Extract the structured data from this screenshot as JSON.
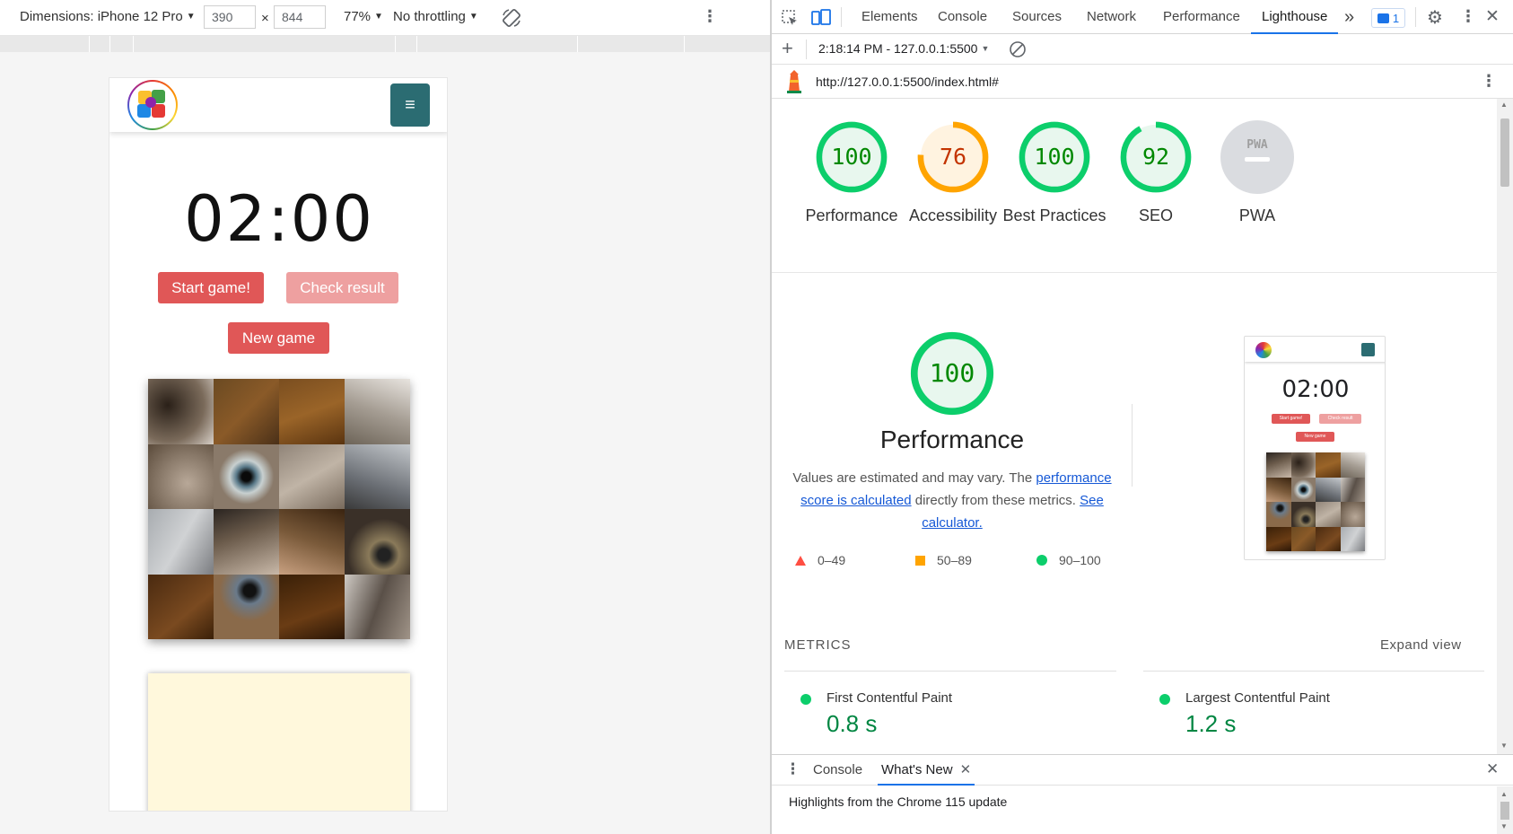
{
  "device_toolbar": {
    "dimensions_label": "Dimensions: iPhone 12 Pro",
    "width": "390",
    "height": "844",
    "times": "×",
    "zoom": "77%",
    "throttling": "No throttling",
    "rotate_icon": "rotate-icon",
    "more_icon": "more-vert-icon"
  },
  "app": {
    "timer": "02:00",
    "start_button": "Start game!",
    "check_button": "Check result",
    "new_game_button": "New game",
    "menu_icon": "≡",
    "colors": {
      "nav_button": "#2b6c72",
      "button": "#e05757",
      "button_disabled": "#eea0a0",
      "answer_box": "#fff8dc"
    }
  },
  "devtools": {
    "tabs": [
      "Elements",
      "Console",
      "Sources",
      "Network",
      "Performance",
      "Lighthouse"
    ],
    "active_tab": "Lighthouse",
    "overflow": "»",
    "issues_count": "1",
    "report_time": "2:18:14 PM - 127.0.0.1:5500",
    "url": "http://127.0.0.1:5500/index.html#"
  },
  "gauges": [
    {
      "label": "Performance",
      "score": "100",
      "value": 100,
      "color": "#0cce6b",
      "text_color": "#008800"
    },
    {
      "label": "Accessibility",
      "score": "76",
      "value": 76,
      "color": "#ffa400",
      "text_color": "#c33300"
    },
    {
      "label": "Best Practices",
      "score": "100",
      "value": 100,
      "color": "#0cce6b",
      "text_color": "#008800"
    },
    {
      "label": "SEO",
      "score": "92",
      "value": 92,
      "color": "#0cce6b",
      "text_color": "#008800"
    },
    {
      "label": "PWA",
      "score": "PWA",
      "value": 0,
      "color": "#dadce0",
      "text_color": "#9e9e9e"
    }
  ],
  "performance": {
    "score": "100",
    "title": "Performance",
    "desc_prefix": "Values are estimated and may vary. The ",
    "desc_link1": "performance score is calculated",
    "desc_middle": " directly from these metrics. ",
    "desc_link2": "See calculator.",
    "legend": [
      {
        "range": "0–49",
        "shape": "triangle",
        "color": "#ff4e42"
      },
      {
        "range": "50–89",
        "shape": "square",
        "color": "#ffa400"
      },
      {
        "range": "90–100",
        "shape": "circle",
        "color": "#0cce6b"
      }
    ],
    "thumb": {
      "timer": "02:00",
      "start": "Start game!",
      "check": "Check result",
      "new_game": "New game"
    }
  },
  "metrics": {
    "title": "METRICS",
    "expand": "Expand view",
    "items": [
      {
        "name": "First Contentful Paint",
        "value": "0.8 s"
      },
      {
        "name": "Largest Contentful Paint",
        "value": "1.2 s"
      }
    ]
  },
  "drawer": {
    "tabs": [
      "Console",
      "What's New"
    ],
    "active_tab": "What's New",
    "content": "Highlights from the Chrome 115 update"
  }
}
